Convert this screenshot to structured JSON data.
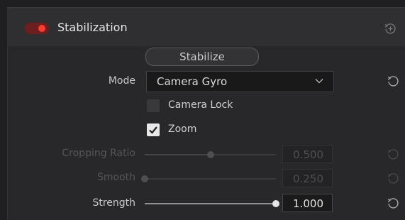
{
  "section": {
    "title": "Stabilization",
    "enabled": true
  },
  "stabilize_button": {
    "label": "Stabilize"
  },
  "mode": {
    "label": "Mode",
    "value": "Camera Gyro"
  },
  "camera_lock": {
    "label": "Camera Lock",
    "checked": false
  },
  "zoom": {
    "label": "Zoom",
    "checked": true
  },
  "cropping_ratio": {
    "label": "Cropping Ratio",
    "value": "0.500",
    "fraction": 0.5,
    "enabled": false
  },
  "smooth": {
    "label": "Smooth",
    "value": "0.250",
    "fraction": 0.0,
    "enabled": false
  },
  "strength": {
    "label": "Strength",
    "value": "1.000",
    "fraction": 1.0,
    "enabled": true
  },
  "icons": {
    "toggle": "power-toggle-icon",
    "section_reset": "reset-plus-icon",
    "reset": "reset-icon",
    "dropdown": "chevron-down-icon",
    "check": "checkmark-icon"
  },
  "colors": {
    "toggle_on": "#ff3b30",
    "panel": "#28282a",
    "text": "#d6d6d6"
  }
}
